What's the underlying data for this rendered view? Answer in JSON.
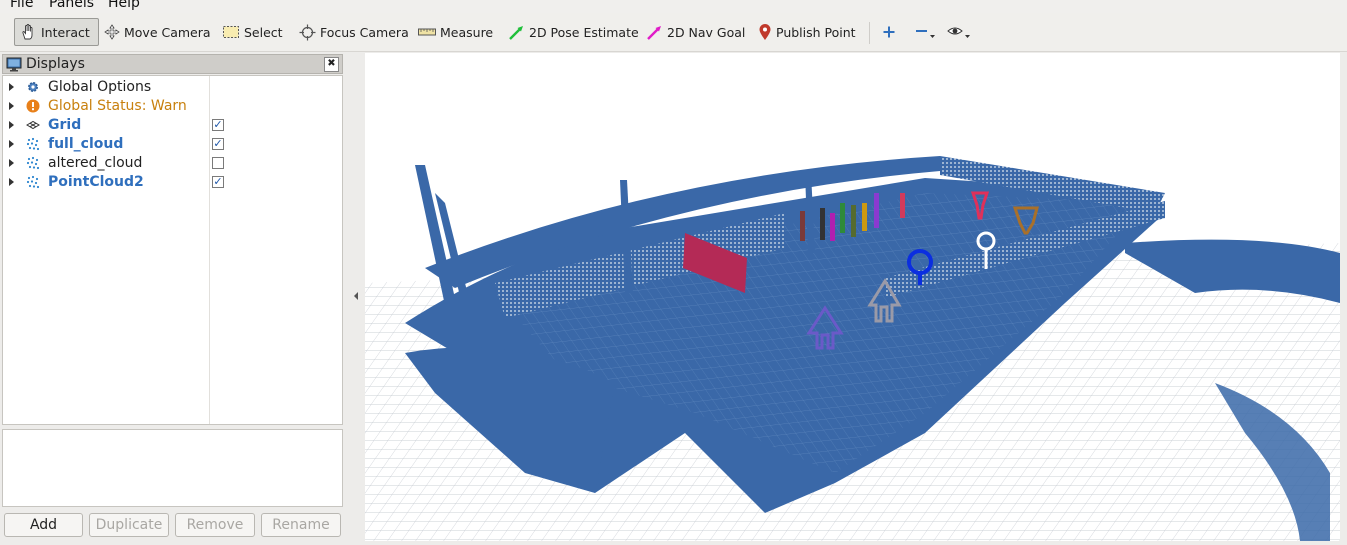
{
  "menu": {
    "file": "File",
    "panels": "Panels",
    "help": "Help"
  },
  "toolbar": {
    "interact": "Interact",
    "move_camera": "Move Camera",
    "select": "Select",
    "focus_camera": "Focus Camera",
    "measure": "Measure",
    "pose_estimate": "2D Pose Estimate",
    "nav_goal": "2D Nav Goal",
    "publish_point": "Publish Point",
    "icons": [
      "hand-icon",
      "move-camera-icon",
      "select-icon",
      "focus-icon",
      "ruler-icon",
      "green-arrow-icon",
      "magenta-arrow-icon",
      "map-pin-icon",
      "plus-icon",
      "minus-icon",
      "eye-icon"
    ]
  },
  "displays_panel": {
    "title": "Displays",
    "items": [
      {
        "label": "Global Options",
        "icon": "gear-icon",
        "checked": null
      },
      {
        "label": "Global Status: Warn",
        "icon": "warning-icon",
        "checked": null
      },
      {
        "label": "Grid",
        "icon": "grid-icon",
        "checked": true
      },
      {
        "label": "full_cloud",
        "icon": "pointcloud-icon",
        "checked": true
      },
      {
        "label": "altered_cloud",
        "icon": "pointcloud-icon",
        "checked": false
      },
      {
        "label": "PointCloud2",
        "icon": "pointcloud-icon",
        "checked": true
      }
    ],
    "buttons": {
      "add": "Add",
      "duplicate": "Duplicate",
      "remove": "Remove",
      "rename": "Rename"
    }
  },
  "colors": {
    "pointcloud": "#3a68a8",
    "grid": "#b8c0c8",
    "warn": "#e08a1a",
    "selected_blue": "#2f6fbd"
  }
}
